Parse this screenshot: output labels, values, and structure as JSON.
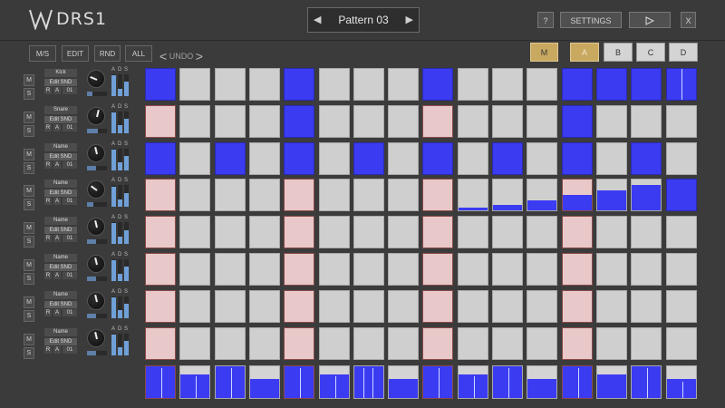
{
  "app": {
    "name": "DRS1"
  },
  "header": {
    "pattern_label": "Pattern 03",
    "help_label": "?",
    "settings_label": "SETTINGS",
    "close_label": "X"
  },
  "toolbar": {
    "ms_label": "M/S",
    "edit_label": "EDIT",
    "rnd_label": "RND",
    "all_label": "ALL",
    "undo_label": "UNDO",
    "m_label": "M"
  },
  "banks": [
    "A",
    "B",
    "C",
    "D"
  ],
  "active_bank": "A",
  "colors": {
    "step_on": "#3b3bf2",
    "step_off": "#cfcfcf",
    "beat_marker": "#e8c8c8",
    "accent_gold": "#c8a45a",
    "meter": "#6fa0d8"
  },
  "tracks": [
    {
      "name": "Kick",
      "snd": "Edit SND",
      "r": "R",
      "a": "A",
      "num": "01",
      "m": "M",
      "s": "S",
      "ads": [
        "A",
        "D",
        "S"
      ],
      "knob": 0.25,
      "env": [
        0.95,
        0.35,
        0.65
      ]
    },
    {
      "name": "Snare",
      "snd": "Edit SND",
      "r": "R",
      "a": "A",
      "num": "01",
      "m": "M",
      "s": "S",
      "ads": [
        "A",
        "D",
        "S"
      ],
      "knob": 0.55,
      "env": [
        0.95,
        0.35,
        0.65
      ]
    },
    {
      "name": "Name",
      "snd": "Edit SND",
      "r": "R",
      "a": "A",
      "num": "01",
      "m": "M",
      "s": "S",
      "ads": [
        "A",
        "D",
        "S"
      ],
      "knob": 0.45,
      "env": [
        0.95,
        0.35,
        0.65
      ]
    },
    {
      "name": "Name",
      "snd": "Edit SND",
      "r": "R",
      "a": "A",
      "num": "01",
      "m": "M",
      "s": "S",
      "ads": [
        "A",
        "D",
        "S"
      ],
      "knob": 0.3,
      "env": [
        0.95,
        0.35,
        0.65
      ]
    },
    {
      "name": "Name",
      "snd": "Edit SND",
      "r": "R",
      "a": "A",
      "num": "01",
      "m": "M",
      "s": "S",
      "ads": [
        "A",
        "D",
        "S"
      ],
      "knob": 0.45,
      "env": [
        0.95,
        0.35,
        0.65
      ]
    },
    {
      "name": "Name",
      "snd": "Edit SND",
      "r": "R",
      "a": "A",
      "num": "01",
      "m": "M",
      "s": "S",
      "ads": [
        "A",
        "D",
        "S"
      ],
      "knob": 0.45,
      "env": [
        0.95,
        0.35,
        0.65
      ]
    },
    {
      "name": "Name",
      "snd": "Edit SND",
      "r": "R",
      "a": "A",
      "num": "01",
      "m": "M",
      "s": "S",
      "ads": [
        "A",
        "D",
        "S"
      ],
      "knob": 0.45,
      "env": [
        0.95,
        0.35,
        0.65
      ]
    },
    {
      "name": "Name",
      "snd": "Edit SND",
      "r": "R",
      "a": "A",
      "num": "01",
      "m": "M",
      "s": "S",
      "ads": [
        "A",
        "D",
        "S"
      ],
      "knob": 0.45,
      "env": [
        0.95,
        0.35,
        0.65
      ]
    }
  ],
  "steps": [
    [
      1,
      0,
      0,
      0,
      1,
      0,
      0,
      0,
      1,
      0,
      0,
      0,
      1,
      1,
      1,
      1
    ],
    [
      0,
      0,
      0,
      0,
      1,
      0,
      0,
      0,
      0,
      0,
      0,
      0,
      1,
      0,
      0,
      0
    ],
    [
      1,
      0,
      1,
      0,
      1,
      0,
      1,
      0,
      1,
      0,
      1,
      0,
      1,
      0,
      1,
      0
    ],
    [
      0,
      0,
      0,
      0,
      0,
      0,
      0,
      0,
      0,
      0.1,
      0.2,
      0.35,
      0.5,
      0.65,
      0.85,
      1
    ],
    [
      0,
      0,
      0,
      0,
      0,
      0,
      0,
      0,
      0,
      0,
      0,
      0,
      0,
      0,
      0,
      0
    ],
    [
      0,
      0,
      0,
      0,
      0,
      0,
      0,
      0,
      0,
      0,
      0,
      0,
      0,
      0,
      0,
      0
    ],
    [
      0,
      0,
      0,
      0,
      0,
      0,
      0,
      0,
      0,
      0,
      0,
      0,
      0,
      0,
      0,
      0
    ],
    [
      0,
      0,
      0,
      0,
      0,
      0,
      0,
      0,
      0,
      0,
      0,
      0,
      0,
      0,
      0,
      0
    ]
  ],
  "step_lengths": [
    1,
    0.75,
    1,
    0.6,
    1,
    0.75,
    1,
    0.6,
    1,
    0.75,
    1,
    0.6,
    1,
    0.75,
    1,
    0.6
  ],
  "step_ticks": [
    [
      0.5
    ],
    [
      0.5
    ],
    [
      0.5
    ],
    [],
    [
      0.5
    ],
    [
      0.5
    ],
    [
      0.3,
      0.6
    ],
    [],
    [
      0.5
    ],
    [
      0.5
    ],
    [
      0.5
    ],
    [],
    [
      0.5
    ],
    [],
    [
      0.5
    ],
    [
      0.5
    ]
  ]
}
